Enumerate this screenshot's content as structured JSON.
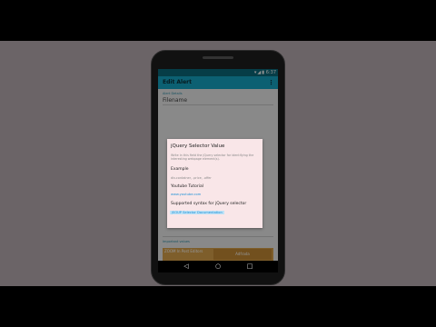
{
  "status_bar": {
    "time": "6:37",
    "icons": [
      "wifi-icon",
      "signal-icon",
      "battery-icon"
    ]
  },
  "app_bar": {
    "title": "Edit Alert",
    "overflow_label": "⋮"
  },
  "background": {
    "section1_label": "Alert Details",
    "field1": "Filename",
    "section2_label": "Important values",
    "banner_left": "ZOOM In Post Editors",
    "banner_right": "Adfrada"
  },
  "dialog": {
    "title": "jQuery Selector Value",
    "description": "Write in this field the jQuery selector for identifying the interesting webpage element(s).",
    "example_heading": "Example",
    "example_text": "div.container, .price, .offer",
    "youtube_heading": "Youtube Tutorial",
    "youtube_link": "www.youtube.com",
    "syntax_heading": "Supported syntax for jQuery selector",
    "syntax_link": "JSOUP Selector Documentation"
  },
  "nav_bar": {
    "back": "◁",
    "home": "○",
    "recent": "□"
  },
  "colors": {
    "app_bar": "#16a6c4",
    "status_bar": "#0b6a7a",
    "dialog_bg": "#f9e6e8",
    "link": "#1a8fd6"
  }
}
